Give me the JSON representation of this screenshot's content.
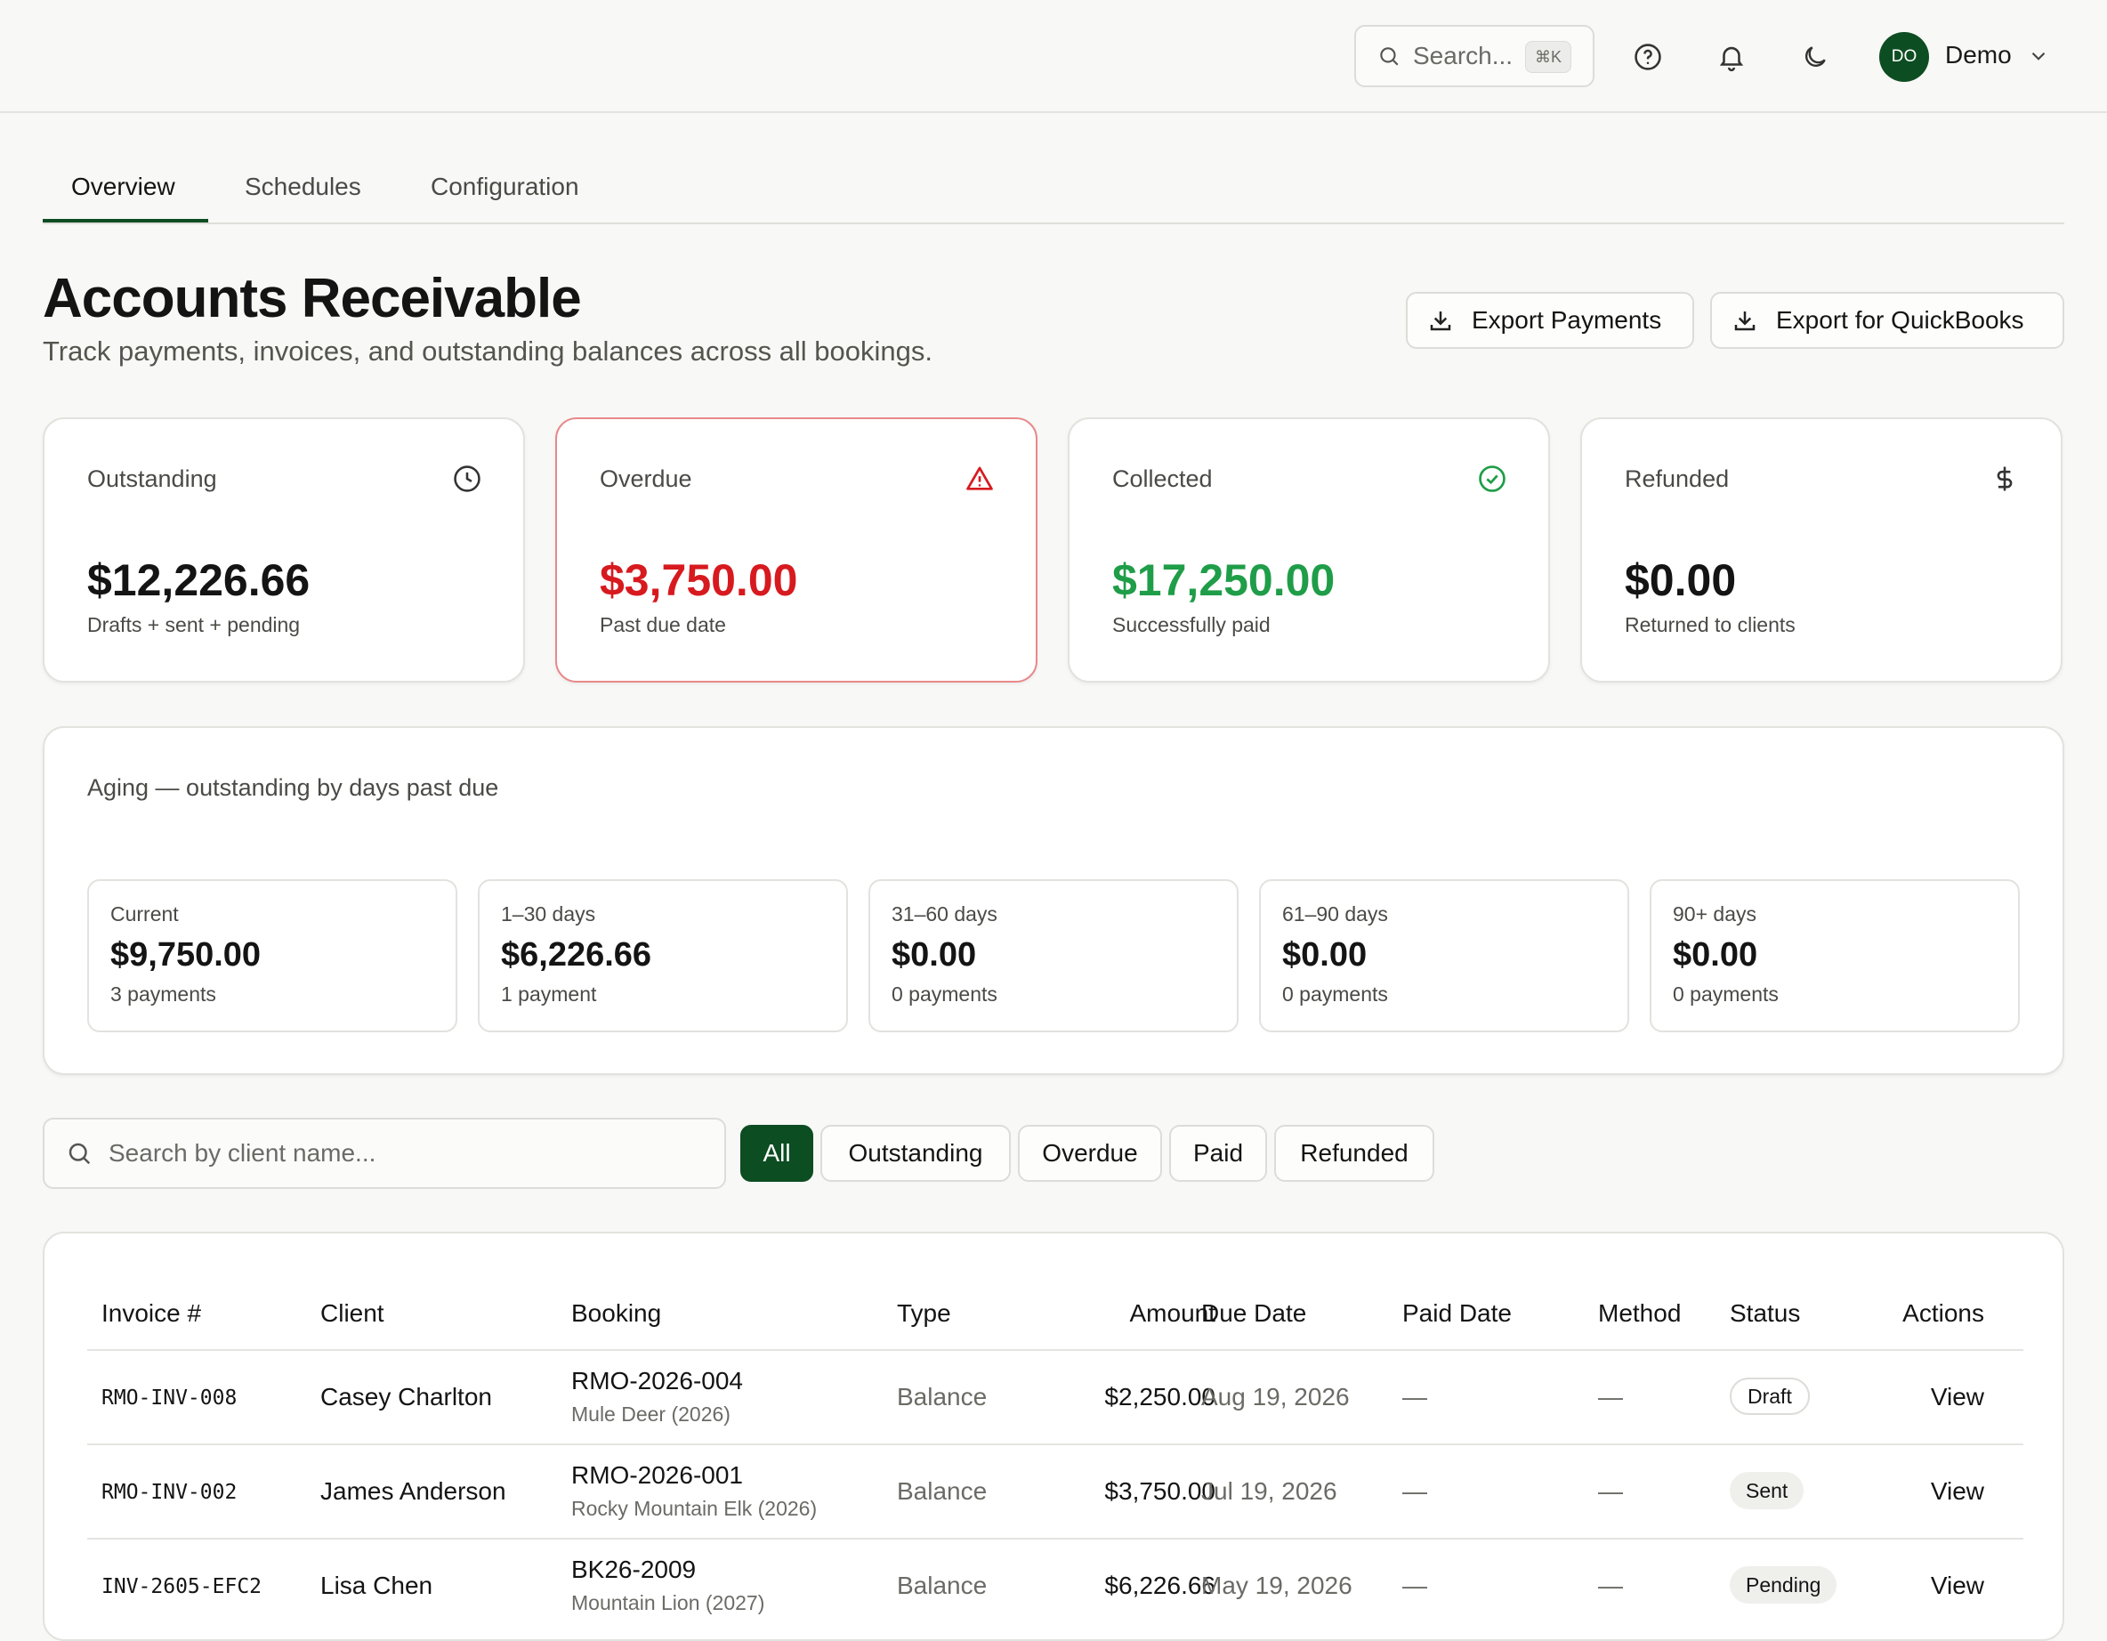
{
  "topbar": {
    "search_placeholder": "Search...",
    "search_shortcut": "⌘K",
    "user_initials": "DO",
    "user_name": "Demo"
  },
  "tabs": [
    {
      "label": "Overview",
      "active": true
    },
    {
      "label": "Schedules",
      "active": false
    },
    {
      "label": "Configuration",
      "active": false
    }
  ],
  "header": {
    "title": "Accounts Receivable",
    "subtitle": "Track payments, invoices, and outstanding balances across all bookings.",
    "export_payments_label": "Export Payments",
    "export_quickbooks_label": "Export for QuickBooks"
  },
  "stats": [
    {
      "label": "Outstanding",
      "value": "$12,226.66",
      "sub": "Drafts + sent + pending",
      "icon": "clock-icon",
      "color": "#141414"
    },
    {
      "label": "Overdue",
      "value": "$3,750.00",
      "sub": "Past due date",
      "icon": "warning-icon",
      "color": "#d71a1f"
    },
    {
      "label": "Collected",
      "value": "$17,250.00",
      "sub": "Successfully paid",
      "icon": "check-circle-icon",
      "color": "#1f9d48"
    },
    {
      "label": "Refunded",
      "value": "$0.00",
      "sub": "Returned to clients",
      "icon": "dollar-icon",
      "color": "#141414"
    }
  ],
  "aging": {
    "title": "Aging — outstanding by days past due",
    "buckets": [
      {
        "label": "Current",
        "value": "$9,750.00",
        "count": "3 payments"
      },
      {
        "label": "1–30 days",
        "value": "$6,226.66",
        "count": "1 payment"
      },
      {
        "label": "31–60 days",
        "value": "$0.00",
        "count": "0 payments"
      },
      {
        "label": "61–90 days",
        "value": "$0.00",
        "count": "0 payments"
      },
      {
        "label": "90+ days",
        "value": "$0.00",
        "count": "0 payments"
      }
    ]
  },
  "filters": {
    "search_placeholder": "Search by client name...",
    "options": [
      "All",
      "Outstanding",
      "Overdue",
      "Paid",
      "Refunded"
    ],
    "active": "All"
  },
  "table": {
    "columns": [
      "Invoice #",
      "Client",
      "Booking",
      "Type",
      "Amount",
      "Due Date",
      "Paid Date",
      "Method",
      "Status",
      "Actions"
    ],
    "rows": [
      {
        "invoice": "RMO-INV-008",
        "client": "Casey Charlton",
        "booking": "RMO-2026-004",
        "booking_sub": "Mule Deer (2026)",
        "type": "Balance",
        "amount": "$2,250.00",
        "due": "Aug 19, 2026",
        "paid": "—",
        "method": "—",
        "status": "Draft",
        "action": "View"
      },
      {
        "invoice": "RMO-INV-002",
        "client": "James Anderson",
        "booking": "RMO-2026-001",
        "booking_sub": "Rocky Mountain Elk (2026)",
        "type": "Balance",
        "amount": "$3,750.00",
        "due": "Jul 19, 2026",
        "paid": "—",
        "method": "—",
        "status": "Sent",
        "action": "View"
      },
      {
        "invoice": "INV-2605-EFC2",
        "client": "Lisa Chen",
        "booking": "BK26-2009",
        "booking_sub": "Mountain Lion (2027)",
        "type": "Balance",
        "amount": "$6,226.66",
        "due": "May 19, 2026",
        "paid": "—",
        "method": "—",
        "status": "Pending",
        "action": "View"
      }
    ]
  },
  "colors": {
    "brand": "#0d4d22",
    "danger": "#d71a1f",
    "success": "#1f9d48"
  }
}
